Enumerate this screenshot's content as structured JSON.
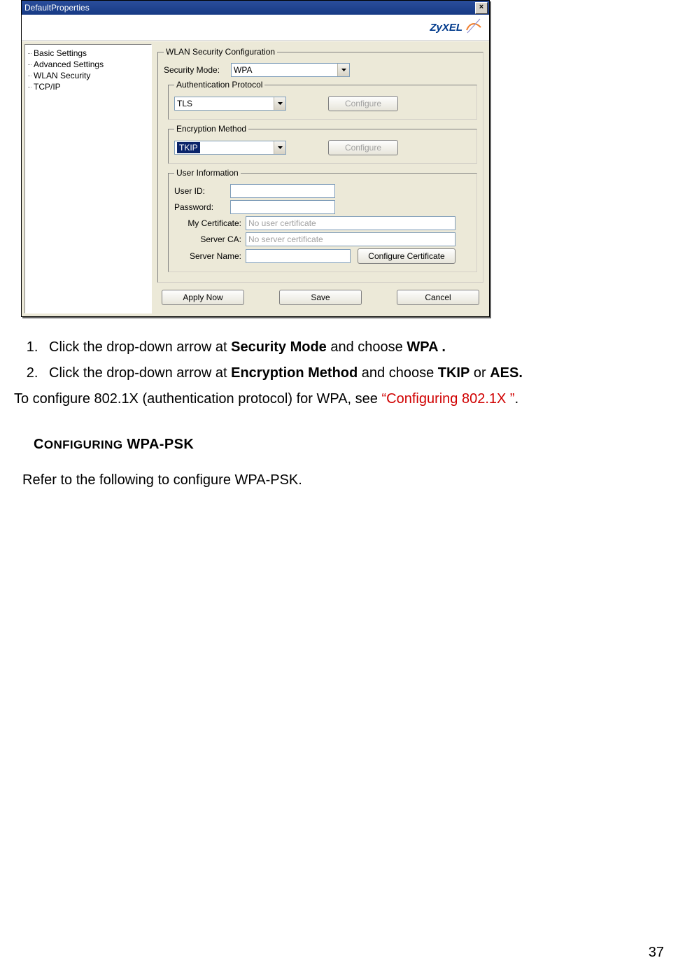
{
  "dialog": {
    "title": "DefaultProperties",
    "close_glyph": "×",
    "brand": "ZyXEL",
    "sidebar": {
      "items": [
        {
          "label": "Basic Settings"
        },
        {
          "label": "Advanced Settings"
        },
        {
          "label": "WLAN Security"
        },
        {
          "label": "TCP/IP"
        }
      ]
    },
    "groups": {
      "wlan": "WLAN Security Configuration",
      "auth": "Authentication Protocol",
      "enc": "Encryption Method",
      "user": "User Information"
    },
    "labels": {
      "security_mode": "Security Mode:",
      "user_id": "User ID:",
      "password": "Password:",
      "my_cert": "My Certificate:",
      "server_ca": "Server CA:",
      "server_name": "Server Name:"
    },
    "fields": {
      "security_mode": "WPA",
      "auth_protocol": "TLS",
      "encryption": "TKIP",
      "user_id": "",
      "password": "",
      "my_cert_placeholder": "No user certificate",
      "server_ca_placeholder": "No server certificate",
      "server_name": ""
    },
    "buttons": {
      "configure_auth": "Configure",
      "configure_enc": "Configure",
      "configure_cert": "Configure Certificate",
      "apply": "Apply Now",
      "save": "Save",
      "cancel": "Cancel"
    }
  },
  "doc": {
    "steps": {
      "s1_a": "Click the drop-down arrow at ",
      "s1_b": "Security Mode",
      "s1_c": " and choose ",
      "s1_d": "WPA .",
      "s2_a": "Click the drop-down arrow at ",
      "s2_b": "Encryption Method",
      "s2_c": " and choose ",
      "s2_d": "TKIP",
      "s2_e": " or ",
      "s2_f": "AES."
    },
    "note_a": "To configure 802.1X (authentication protocol) for WPA, see ",
    "note_xref": "“Configuring 802.1X ”",
    "note_b": ".",
    "section_title_1": "C",
    "section_title_2": "ONFIGURING",
    "section_title_3": " WPA-PSK",
    "para1": "Refer to the following to configure WPA-PSK.",
    "page_number": "37"
  }
}
